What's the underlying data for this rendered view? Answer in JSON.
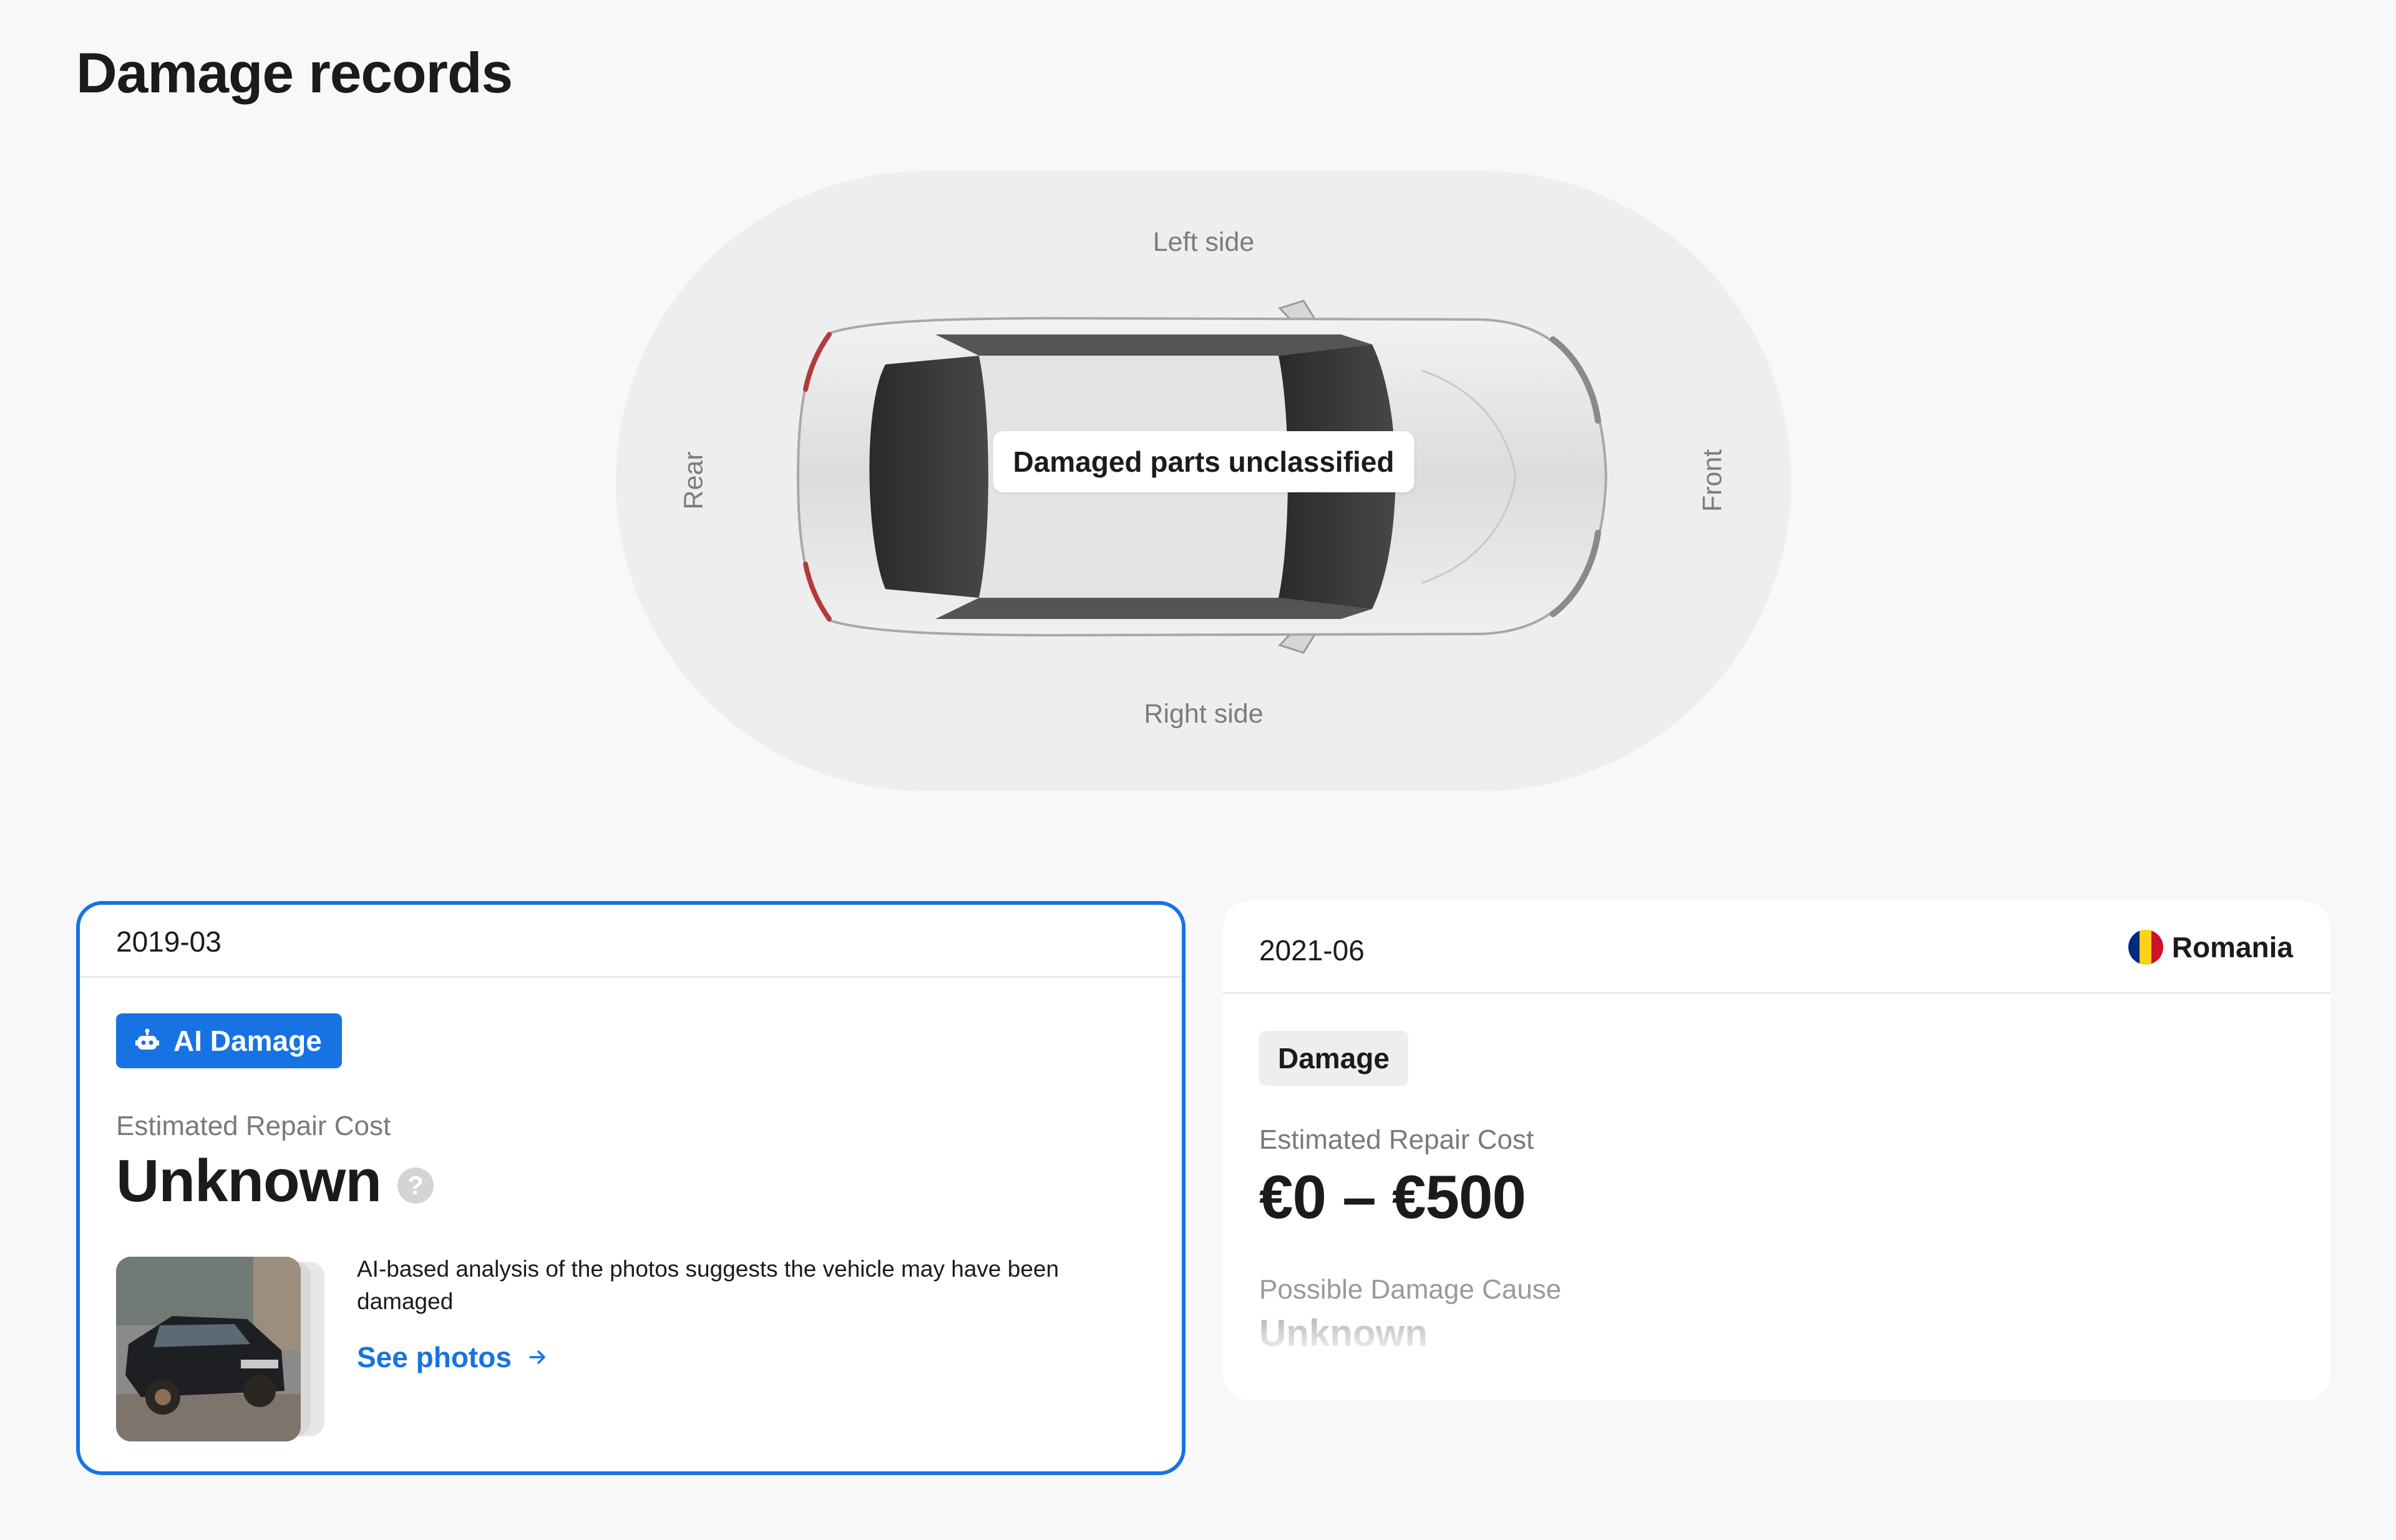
{
  "page": {
    "title": "Damage records"
  },
  "diagram": {
    "left_label": "Left side",
    "right_label": "Right side",
    "rear_label": "Rear",
    "front_label": "Front",
    "status": "Damaged parts unclassified"
  },
  "records": [
    {
      "date": "2019-03",
      "badge": "AI Damage",
      "badge_icon": "robot-icon",
      "cost_label": "Estimated Repair Cost",
      "cost_value": "Unknown",
      "description": "AI-based analysis of the photos suggests the vehicle may have been damaged",
      "link": "See photos",
      "selected": true
    },
    {
      "date": "2021-06",
      "country": "Romania",
      "flag_colors": [
        "#002b7f",
        "#fcd116",
        "#ce1126"
      ],
      "badge": "Damage",
      "cost_label": "Estimated Repair Cost",
      "cost_value": "€0 – €500",
      "cause_label": "Possible Damage Cause",
      "cause_value": "Unknown"
    }
  ],
  "colors": {
    "accent": "#1773e3",
    "background": "#f8f8f8",
    "diagram": "#eeeeee"
  }
}
